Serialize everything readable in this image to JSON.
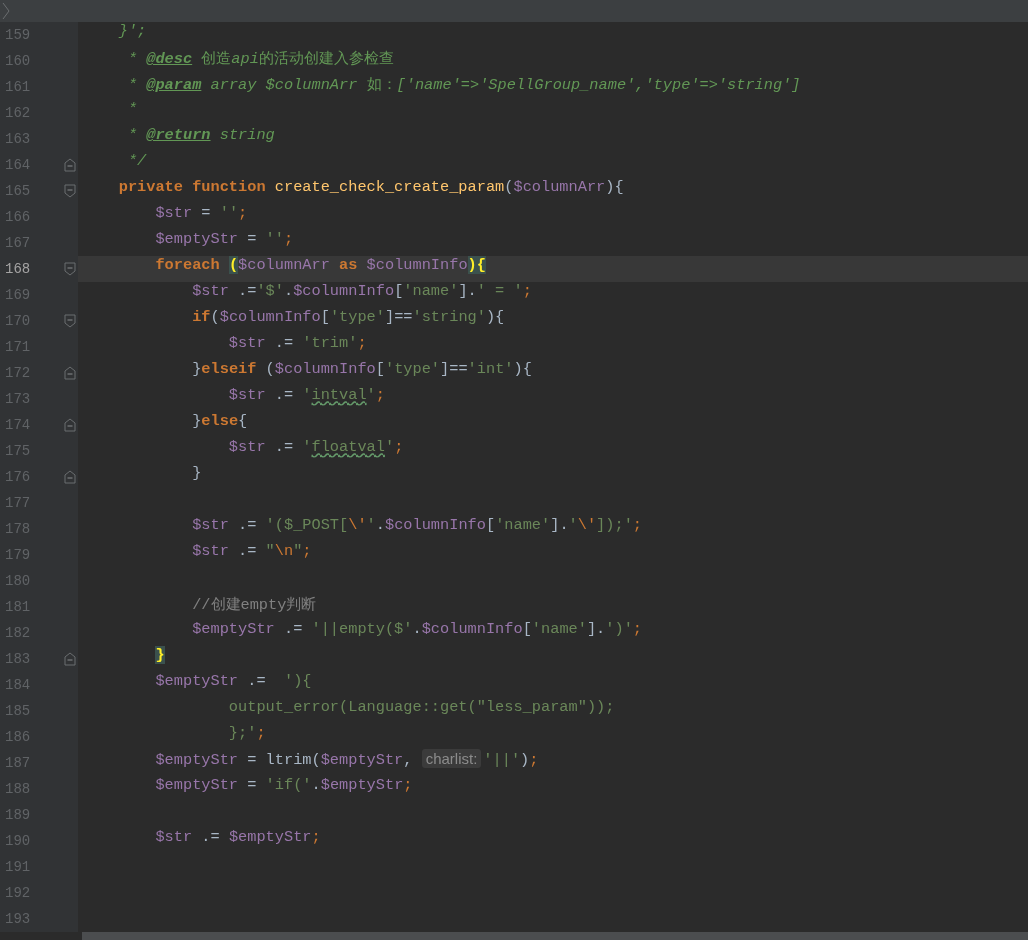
{
  "lines": [
    {
      "number": "159",
      "kind": "plain",
      "current": false,
      "tokens": [
        {
          "kind": "doc",
          "text": "    }';"
        }
      ]
    },
    {
      "number": "160",
      "kind": "plain",
      "current": false,
      "tokens": [
        {
          "kind": "doc",
          "text": "     * "
        },
        {
          "kind": "doctag",
          "text": "@desc"
        },
        {
          "kind": "docplain",
          "text": " 创造"
        },
        {
          "kind": "doc",
          "text": "api"
        },
        {
          "kind": "docplain",
          "text": "的活动创建入参检查"
        }
      ]
    },
    {
      "number": "161",
      "kind": "plain",
      "current": false,
      "tokens": [
        {
          "kind": "doc",
          "text": "     * "
        },
        {
          "kind": "doctag",
          "text": "@param"
        },
        {
          "kind": "doc",
          "text": " array $columnArr "
        },
        {
          "kind": "docplain",
          "text": "如："
        },
        {
          "kind": "doc",
          "text": "['name'=>'SpellGroup_name','type'=>'string']"
        }
      ]
    },
    {
      "number": "162",
      "kind": "plain",
      "current": false,
      "tokens": [
        {
          "kind": "doc",
          "text": "     *"
        }
      ]
    },
    {
      "number": "163",
      "kind": "plain",
      "current": false,
      "tokens": [
        {
          "kind": "doc",
          "text": "     * "
        },
        {
          "kind": "doctag",
          "text": "@return"
        },
        {
          "kind": "doc",
          "text": " string"
        }
      ]
    },
    {
      "number": "164",
      "kind": "closer",
      "current": false,
      "tokens": [
        {
          "kind": "doc",
          "text": "     */"
        }
      ]
    },
    {
      "number": "165",
      "kind": "opener",
      "current": false,
      "tokens": [
        {
          "kind": "keyword",
          "text": "    private function "
        },
        {
          "kind": "func",
          "text": "create_check_create_param"
        },
        {
          "kind": "plain",
          "text": "("
        },
        {
          "kind": "var",
          "text": "$columnArr"
        },
        {
          "kind": "plain",
          "text": "){"
        }
      ]
    },
    {
      "number": "166",
      "kind": "plain",
      "current": false,
      "tokens": [
        {
          "kind": "var",
          "text": "        $str"
        },
        {
          "kind": "plain",
          "text": " = "
        },
        {
          "kind": "string",
          "text": "''"
        },
        {
          "kind": "punct",
          "text": ";"
        }
      ]
    },
    {
      "number": "167",
      "kind": "plain",
      "current": false,
      "tokens": [
        {
          "kind": "var",
          "text": "        $emptyStr"
        },
        {
          "kind": "plain",
          "text": " = "
        },
        {
          "kind": "string",
          "text": "''"
        },
        {
          "kind": "punct",
          "text": ";"
        }
      ]
    },
    {
      "number": "168",
      "kind": "opener",
      "current": true,
      "tokens": [
        {
          "kind": "keyword",
          "text": "        foreach "
        },
        {
          "kind": "match",
          "text": "("
        },
        {
          "kind": "var",
          "text": "$columnArr "
        },
        {
          "kind": "keyword",
          "text": "as "
        },
        {
          "kind": "var",
          "text": "$columnInfo"
        },
        {
          "kind": "match",
          "text": ")"
        },
        {
          "kind": "match",
          "text": "{"
        }
      ]
    },
    {
      "number": "169",
      "kind": "plain",
      "current": false,
      "tokens": [
        {
          "kind": "var",
          "text": "            $str"
        },
        {
          "kind": "plain",
          "text": " ."
        },
        {
          "kind": "plain",
          "text": "="
        },
        {
          "kind": "string",
          "text": "'$'"
        },
        {
          "kind": "plain",
          "text": "."
        },
        {
          "kind": "var",
          "text": "$columnInfo"
        },
        {
          "kind": "plain",
          "text": "["
        },
        {
          "kind": "string",
          "text": "'name'"
        },
        {
          "kind": "plain",
          "text": "]."
        },
        {
          "kind": "string",
          "text": "' = '"
        },
        {
          "kind": "punct",
          "text": ";"
        }
      ]
    },
    {
      "number": "170",
      "kind": "opener",
      "current": false,
      "tokens": [
        {
          "kind": "keyword",
          "text": "            if"
        },
        {
          "kind": "plain",
          "text": "("
        },
        {
          "kind": "var",
          "text": "$columnInfo"
        },
        {
          "kind": "plain",
          "text": "["
        },
        {
          "kind": "string",
          "text": "'type'"
        },
        {
          "kind": "plain",
          "text": "]=="
        },
        {
          "kind": "string",
          "text": "'string'"
        },
        {
          "kind": "plain",
          "text": "){"
        }
      ]
    },
    {
      "number": "171",
      "kind": "plain",
      "current": false,
      "tokens": [
        {
          "kind": "var",
          "text": "                $str"
        },
        {
          "kind": "plain",
          "text": " .= "
        },
        {
          "kind": "string",
          "text": "'trim'"
        },
        {
          "kind": "punct",
          "text": ";"
        }
      ]
    },
    {
      "number": "172",
      "kind": "closer",
      "current": false,
      "tokens": [
        {
          "kind": "plain",
          "text": "            }"
        },
        {
          "kind": "keyword",
          "text": "elseif "
        },
        {
          "kind": "plain",
          "text": "("
        },
        {
          "kind": "var",
          "text": "$columnInfo"
        },
        {
          "kind": "plain",
          "text": "["
        },
        {
          "kind": "string",
          "text": "'type'"
        },
        {
          "kind": "plain",
          "text": "]=="
        },
        {
          "kind": "string",
          "text": "'int'"
        },
        {
          "kind": "plain",
          "text": "){"
        }
      ]
    },
    {
      "number": "173",
      "kind": "plain",
      "current": false,
      "tokens": [
        {
          "kind": "var",
          "text": "                $str"
        },
        {
          "kind": "plain",
          "text": " .= "
        },
        {
          "kind": "string",
          "text": "'"
        },
        {
          "kind": "typo",
          "text": "intval"
        },
        {
          "kind": "string",
          "text": "'"
        },
        {
          "kind": "punct",
          "text": ";"
        }
      ]
    },
    {
      "number": "174",
      "kind": "closer",
      "current": false,
      "tokens": [
        {
          "kind": "plain",
          "text": "            }"
        },
        {
          "kind": "keyword",
          "text": "else"
        },
        {
          "kind": "plain",
          "text": "{"
        }
      ]
    },
    {
      "number": "175",
      "kind": "plain",
      "current": false,
      "tokens": [
        {
          "kind": "var",
          "text": "                $str"
        },
        {
          "kind": "plain",
          "text": " .= "
        },
        {
          "kind": "string",
          "text": "'"
        },
        {
          "kind": "typo",
          "text": "floatval"
        },
        {
          "kind": "string",
          "text": "'"
        },
        {
          "kind": "punct",
          "text": ";"
        }
      ]
    },
    {
      "number": "176",
      "kind": "closer",
      "current": false,
      "tokens": [
        {
          "kind": "plain",
          "text": "            }"
        }
      ]
    },
    {
      "number": "177",
      "kind": "plain",
      "current": false
    },
    {
      "number": "178",
      "kind": "plain",
      "current": false,
      "tokens": [
        {
          "kind": "var",
          "text": "            $str"
        },
        {
          "kind": "plain",
          "text": " .= "
        },
        {
          "kind": "string",
          "text": "'($_POST["
        },
        {
          "kind": "escape",
          "text": "\\'"
        },
        {
          "kind": "string",
          "text": "'"
        },
        {
          "kind": "plain",
          "text": "."
        },
        {
          "kind": "var",
          "text": "$columnInfo"
        },
        {
          "kind": "plain",
          "text": "["
        },
        {
          "kind": "string",
          "text": "'name'"
        },
        {
          "kind": "plain",
          "text": "]."
        },
        {
          "kind": "string",
          "text": "'"
        },
        {
          "kind": "escape",
          "text": "\\'"
        },
        {
          "kind": "string",
          "text": "]);'"
        },
        {
          "kind": "punct",
          "text": ";"
        }
      ]
    },
    {
      "number": "179",
      "kind": "plain",
      "current": false,
      "tokens": [
        {
          "kind": "var",
          "text": "            $str"
        },
        {
          "kind": "plain",
          "text": " .= "
        },
        {
          "kind": "string",
          "text": "\""
        },
        {
          "kind": "escape",
          "text": "\\n"
        },
        {
          "kind": "string",
          "text": "\""
        },
        {
          "kind": "punct",
          "text": ";"
        }
      ]
    },
    {
      "number": "180",
      "kind": "plain",
      "current": false
    },
    {
      "number": "181",
      "kind": "plain",
      "current": false,
      "tokens": [
        {
          "kind": "comment",
          "text": "            //创建empty判断"
        }
      ]
    },
    {
      "number": "182",
      "kind": "plain",
      "current": false,
      "tokens": [
        {
          "kind": "var",
          "text": "            $emptyStr"
        },
        {
          "kind": "plain",
          "text": " .= "
        },
        {
          "kind": "string",
          "text": "'||empty($'"
        },
        {
          "kind": "plain",
          "text": "."
        },
        {
          "kind": "var",
          "text": "$columnInfo"
        },
        {
          "kind": "plain",
          "text": "["
        },
        {
          "kind": "string",
          "text": "'name'"
        },
        {
          "kind": "plain",
          "text": "]."
        },
        {
          "kind": "string",
          "text": "')'"
        },
        {
          "kind": "punct",
          "text": ";"
        }
      ]
    },
    {
      "number": "183",
      "kind": "closer",
      "current": false,
      "tokens": [
        {
          "kind": "match",
          "text": "        }"
        }
      ]
    },
    {
      "number": "184",
      "kind": "plain",
      "current": false,
      "tokens": [
        {
          "kind": "var",
          "text": "        $emptyStr"
        },
        {
          "kind": "plain",
          "text": " .=  "
        },
        {
          "kind": "string",
          "text": "'){"
        }
      ]
    },
    {
      "number": "185",
      "kind": "plain",
      "current": false,
      "tokens": [
        {
          "kind": "string",
          "text": "                output_error(Language::get(\"less_param\"));"
        }
      ]
    },
    {
      "number": "186",
      "kind": "plain",
      "current": false,
      "tokens": [
        {
          "kind": "string",
          "text": "                };'"
        },
        {
          "kind": "punct",
          "text": ";"
        }
      ]
    },
    {
      "number": "187",
      "kind": "plain",
      "current": false,
      "tokens": [
        {
          "kind": "var",
          "text": "        $emptyStr"
        },
        {
          "kind": "plain",
          "text": " = ltrim("
        },
        {
          "kind": "var",
          "text": "$emptyStr"
        },
        {
          "kind": "plain",
          "text": ", "
        },
        {
          "kind": "hint",
          "text": "charlist:"
        },
        {
          "kind": "string",
          "text": "'||'"
        },
        {
          "kind": "plain",
          "text": ")"
        },
        {
          "kind": "punct",
          "text": ";"
        }
      ]
    },
    {
      "number": "188",
      "kind": "plain",
      "current": false,
      "tokens": [
        {
          "kind": "var",
          "text": "        $emptyStr"
        },
        {
          "kind": "plain",
          "text": " = "
        },
        {
          "kind": "string",
          "text": "'if('"
        },
        {
          "kind": "plain",
          "text": "."
        },
        {
          "kind": "var",
          "text": "$emptyStr"
        },
        {
          "kind": "punct",
          "text": ";"
        }
      ]
    },
    {
      "number": "189",
      "kind": "plain",
      "current": false
    },
    {
      "number": "190",
      "kind": "plain",
      "current": false,
      "tokens": [
        {
          "kind": "var",
          "text": "        $str"
        },
        {
          "kind": "plain",
          "text": " .= "
        },
        {
          "kind": "var",
          "text": "$emptyStr"
        },
        {
          "kind": "punct",
          "text": ";"
        }
      ]
    },
    {
      "number": "191",
      "kind": "plain",
      "current": false
    },
    {
      "number": "192",
      "kind": "plain",
      "current": false
    },
    {
      "number": "193",
      "kind": "plain",
      "current": false
    }
  ]
}
